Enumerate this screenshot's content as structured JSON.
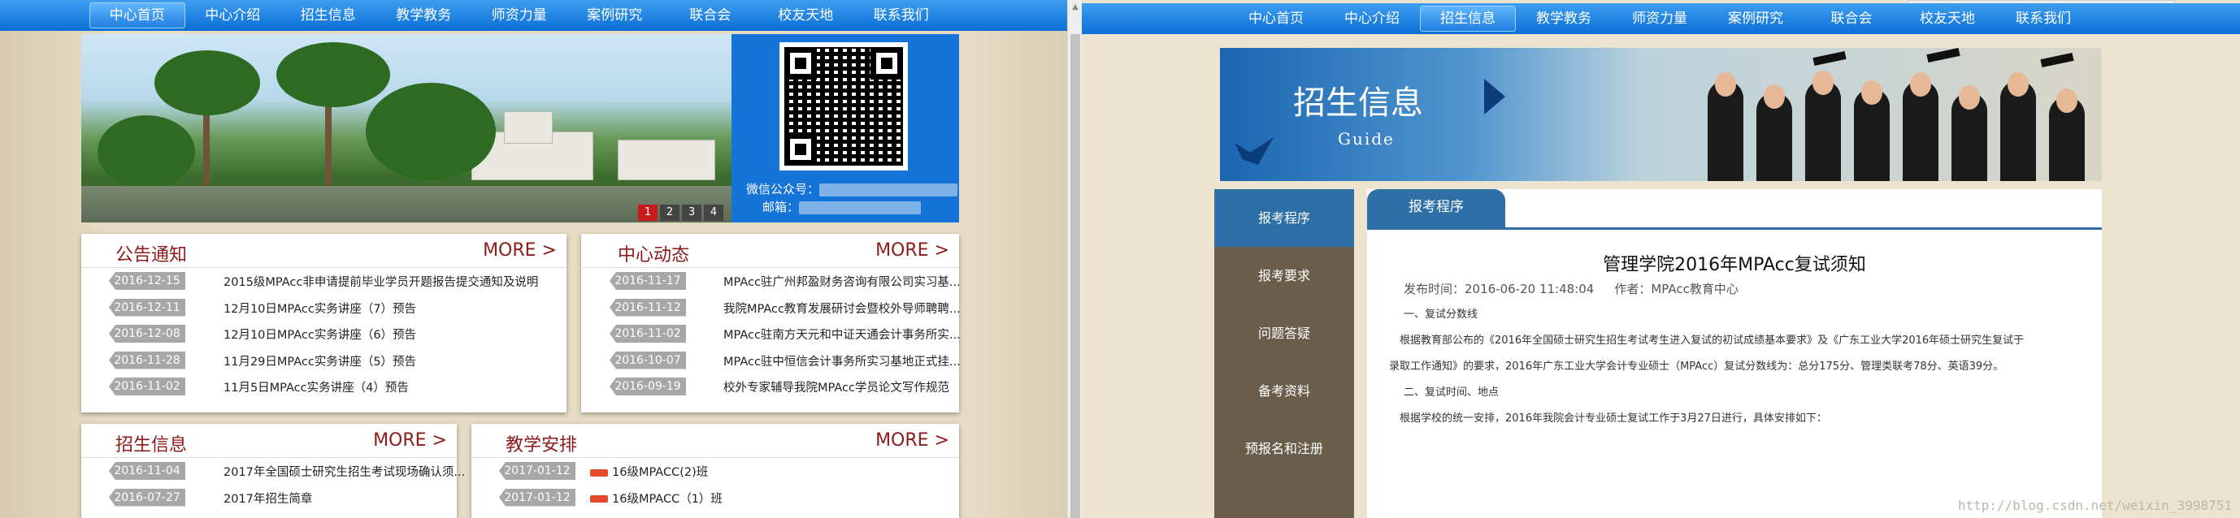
{
  "left": {
    "nav": [
      "中心首页",
      "中心介绍",
      "招生信息",
      "教学教务",
      "师资力量",
      "案例研究",
      "联合会",
      "校友天地",
      "联系我们"
    ],
    "active_nav": 0,
    "slides": [
      "1",
      "2",
      "3",
      "4"
    ],
    "active_slide": 0,
    "wechat_label": "微信公众号：",
    "email_label": "邮箱：",
    "boxes": {
      "notice": {
        "title": "公告通知",
        "more": "MORE >",
        "items": [
          {
            "date": "2016-12-15",
            "text": "2015级MPAcc非申请提前毕业学员开题报告提交通知及说明"
          },
          {
            "date": "2016-12-11",
            "text": "12月10日MPAcc实务讲座（7）预告"
          },
          {
            "date": "2016-12-08",
            "text": "12月10日MPAcc实务讲座（6）预告"
          },
          {
            "date": "2016-11-28",
            "text": "11月29日MPAcc实务讲座（5）预告"
          },
          {
            "date": "2016-11-02",
            "text": "11月5日MPAcc实务讲座（4）预告"
          }
        ]
      },
      "news": {
        "title": "中心动态",
        "more": "MORE >",
        "items": [
          {
            "date": "2016-11-17",
            "text": "MPAcc驻广州邦盈财务咨询有限公司实习基..."
          },
          {
            "date": "2016-11-12",
            "text": "我院MPAcc教育发展研讨会暨校外导师聘聘..."
          },
          {
            "date": "2016-11-02",
            "text": "MPAcc驻南方天元和中证天通会计事务所实..."
          },
          {
            "date": "2016-10-07",
            "text": "MPAcc驻中恒信会计事务所实习基地正式挂..."
          },
          {
            "date": "2016-09-19",
            "text": "校外专家辅导我院MPAcc学员论文写作规范"
          }
        ]
      },
      "admission": {
        "title": "招生信息",
        "more": "MORE >",
        "items": [
          {
            "date": "2016-11-04",
            "text": "2017年全国硕士研究生招生考试现场确认须..."
          },
          {
            "date": "2016-07-27",
            "text": "2017年招生简章"
          }
        ]
      },
      "teaching": {
        "title": "教学安排",
        "more": "MORE >",
        "items": [
          {
            "date": "2017-01-12",
            "text": "16级MPACC(2)班"
          },
          {
            "date": "2017-01-12",
            "text": "16级MPACC（1）班"
          }
        ]
      }
    }
  },
  "right": {
    "nav": [
      "中心首页",
      "中心介绍",
      "招生信息",
      "教学教务",
      "师资力量",
      "案例研究",
      "联合会",
      "校友天地",
      "联系我们"
    ],
    "active_nav": 2,
    "hero_title": "招生信息",
    "hero_subtitle": "Guide",
    "side_nav": [
      "报考程序",
      "报考要求",
      "问题答疑",
      "备考资料",
      "预报名和注册"
    ],
    "active_side": 0,
    "tab_label": "报考程序",
    "article": {
      "title": "管理学院2016年MPAcc复试须知",
      "date": "发布时间：2016-06-20 11:48:04",
      "author": "作者：MPAcc教育中心",
      "p1": "一、复试分数线",
      "p2": "根据教育部公布的《2016年全国硕士研究生招生考试考生进入复试的初试成绩基本要求》及《广东工业大学2016年硕士研究生复试于",
      "p3": "录取工作通知》的要求，2016年广东工业大学会计专业硕士（MPAcc）复试分数线为：总分175分、管理类联考78分、英语39分。",
      "p4": "二、复试时间、地点",
      "p5": "根据学校的统一安排，2016年我院会计专业硕士复试工作于3月27日进行，具体安排如下："
    },
    "watermark": "http://blog.csdn.net/weixin_3998751"
  }
}
